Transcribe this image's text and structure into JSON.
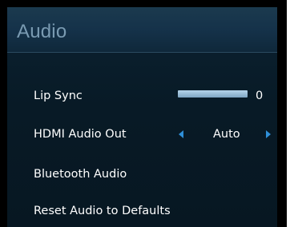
{
  "header": {
    "title": "Audio"
  },
  "menu": {
    "lip_sync": {
      "label": "Lip Sync",
      "value": "0",
      "level": 1.0
    },
    "hdmi_audio_out": {
      "label": "HDMI Audio Out",
      "value": "Auto",
      "left_arrow_icon": "left-arrow-icon",
      "right_arrow_icon": "right-arrow-icon"
    },
    "bluetooth_audio": {
      "label": "Bluetooth Audio"
    },
    "reset_audio": {
      "label": "Reset Audio to Defaults"
    }
  },
  "colors": {
    "accent": "#2f8fd8",
    "title": "#7a9bb2",
    "text": "#ffffff",
    "slider_fill": "#9dc0da"
  }
}
